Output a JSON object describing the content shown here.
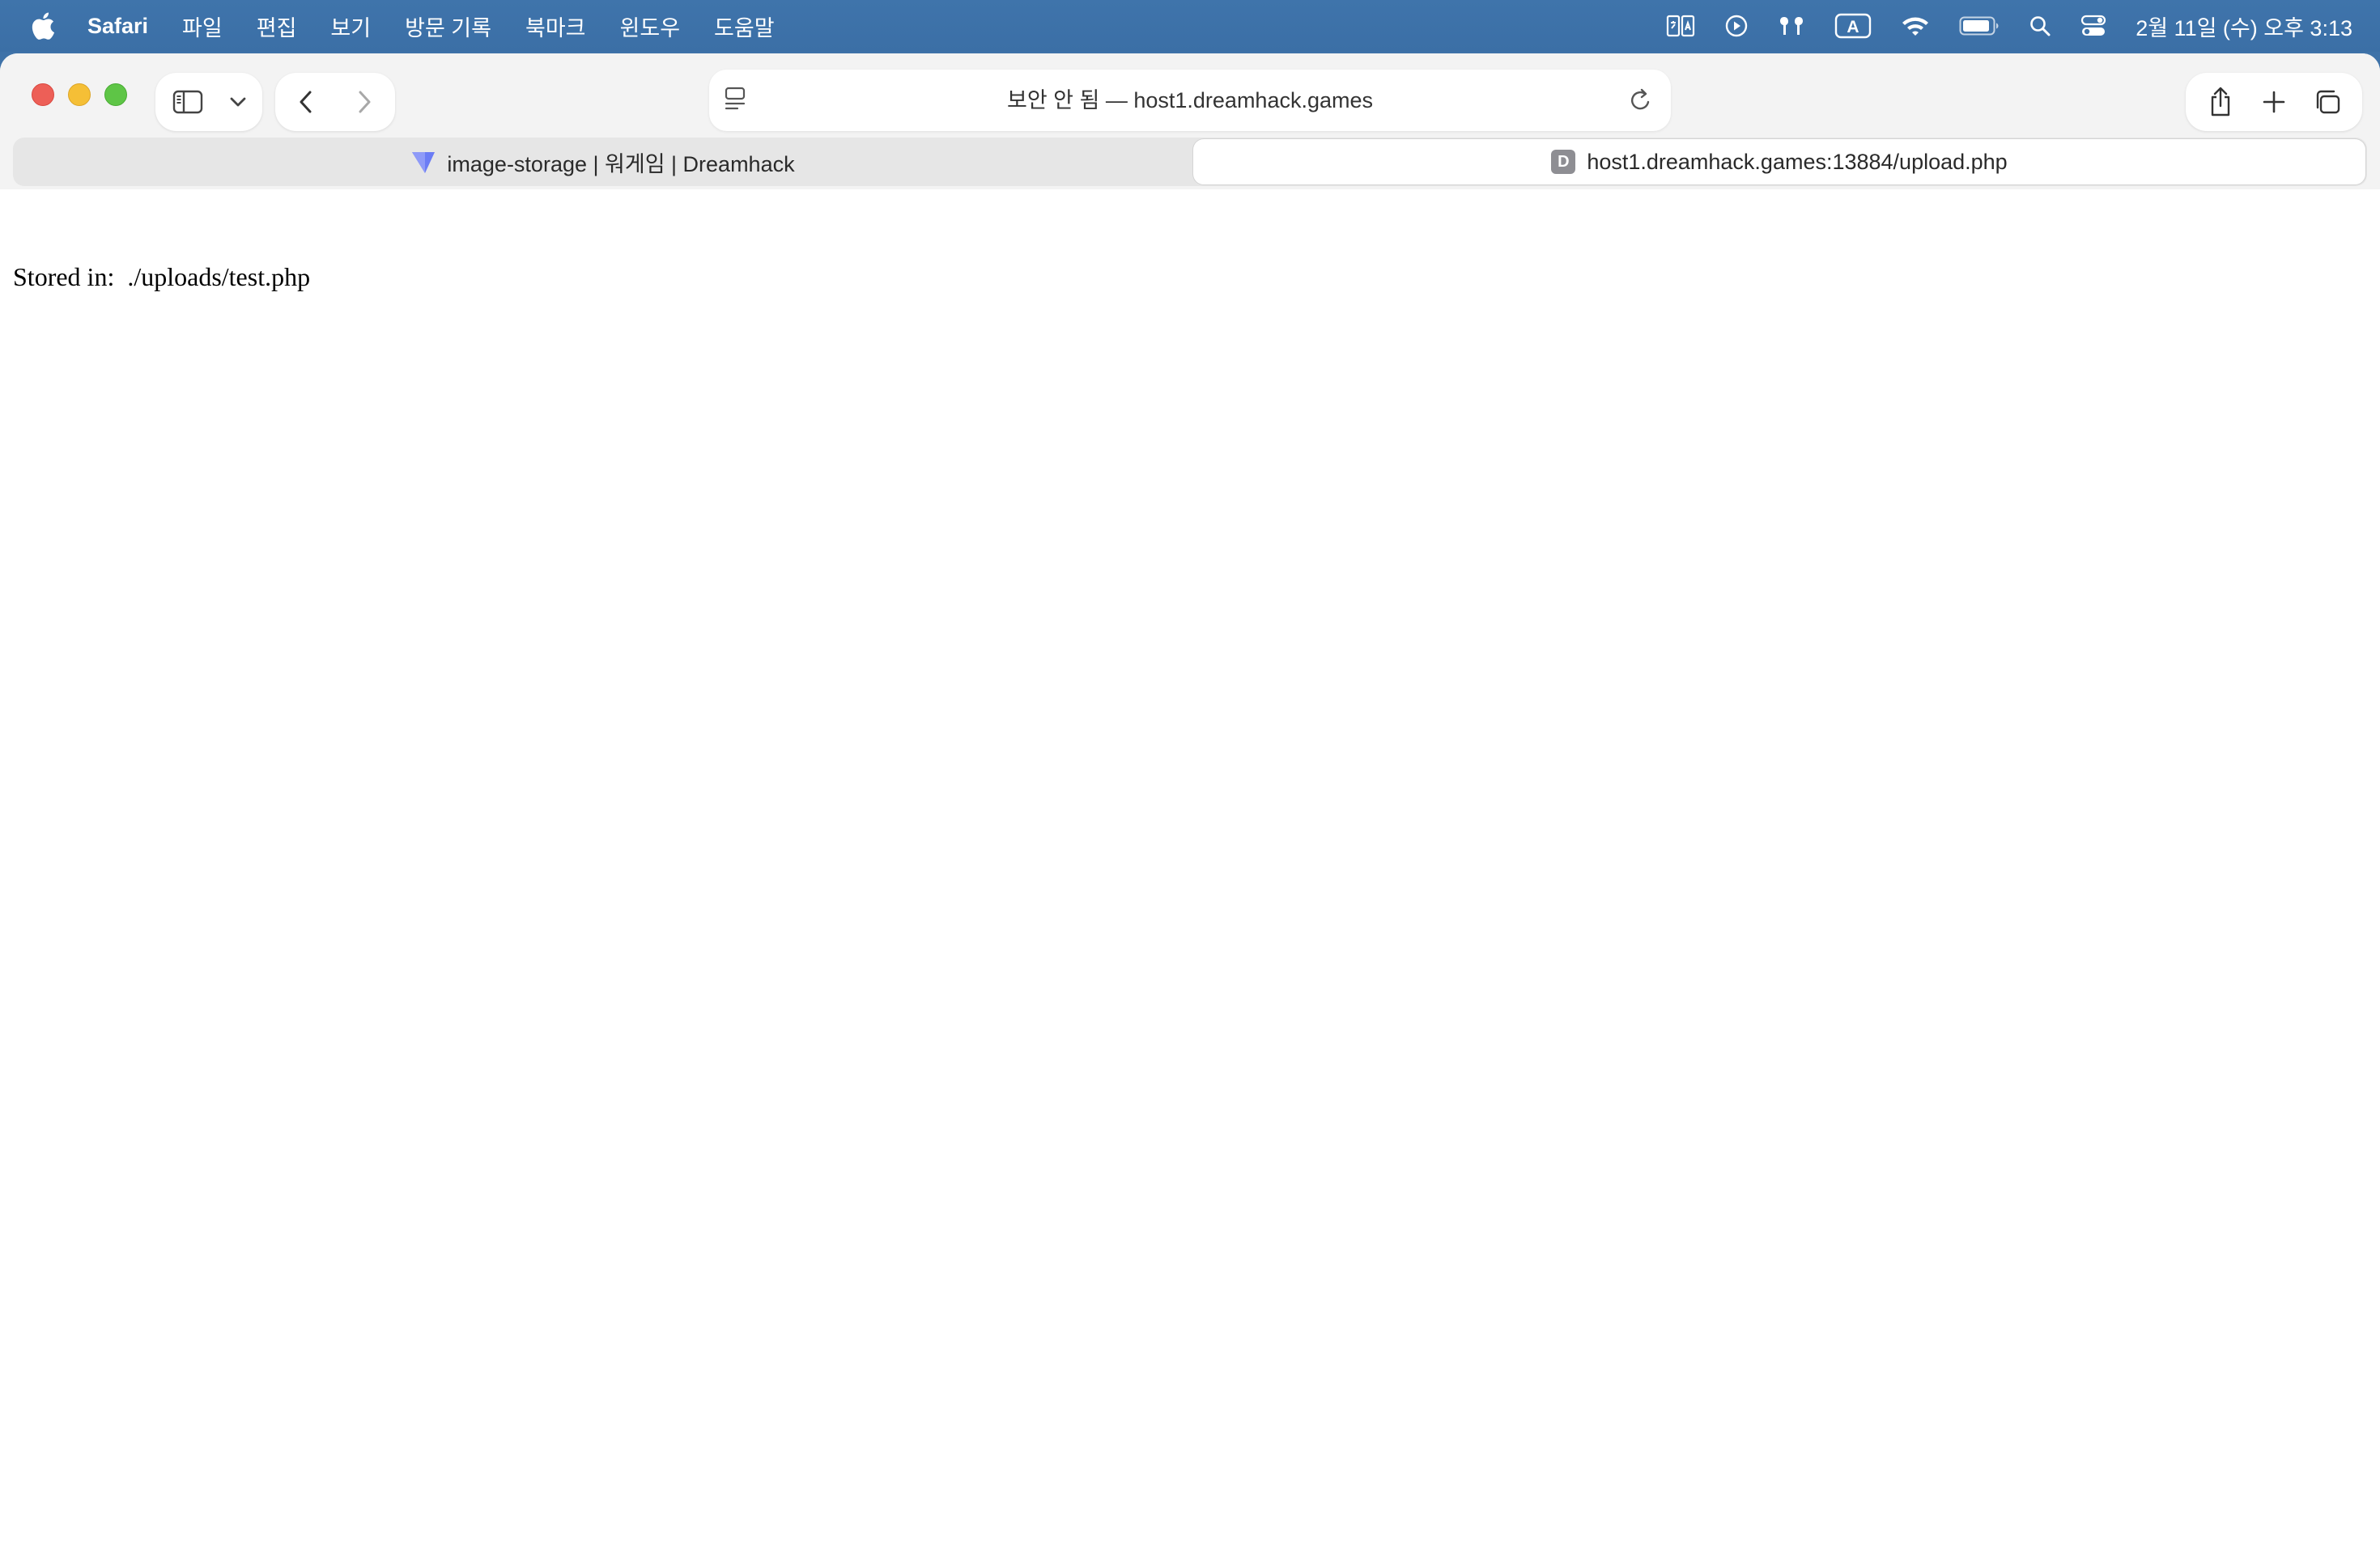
{
  "menubar": {
    "app_name": "Safari",
    "items": [
      "파일",
      "편집",
      "보기",
      "방문 기록",
      "북마크",
      "윈도우",
      "도움말"
    ],
    "clock": "2월 11일 (수) 오후 3:13",
    "input_indicator": "A",
    "status_icons": [
      "translate-icon",
      "play-icon",
      "airpods-icon",
      "input-source-icon",
      "wifi-icon",
      "battery-icon",
      "spotlight-search-icon",
      "control-center-icon"
    ]
  },
  "toolbar": {
    "address_text": "보안 안 됨 — host1.dreamhack.games"
  },
  "tabs": [
    {
      "label": "image-storage | 워게임 | Dreamhack",
      "active": false
    },
    {
      "label": "host1.dreamhack.games:13884/upload.php",
      "active": true,
      "favicon_letter": "D"
    }
  ],
  "page": {
    "stored_text": "Stored in:  ./uploads/test.php"
  },
  "colors": {
    "menubar": "#3e72a8",
    "close": "#ed5f57",
    "minimize": "#f5bf36",
    "zoom": "#5ec546",
    "dreamhack_favicon": "#6b7cf5"
  }
}
